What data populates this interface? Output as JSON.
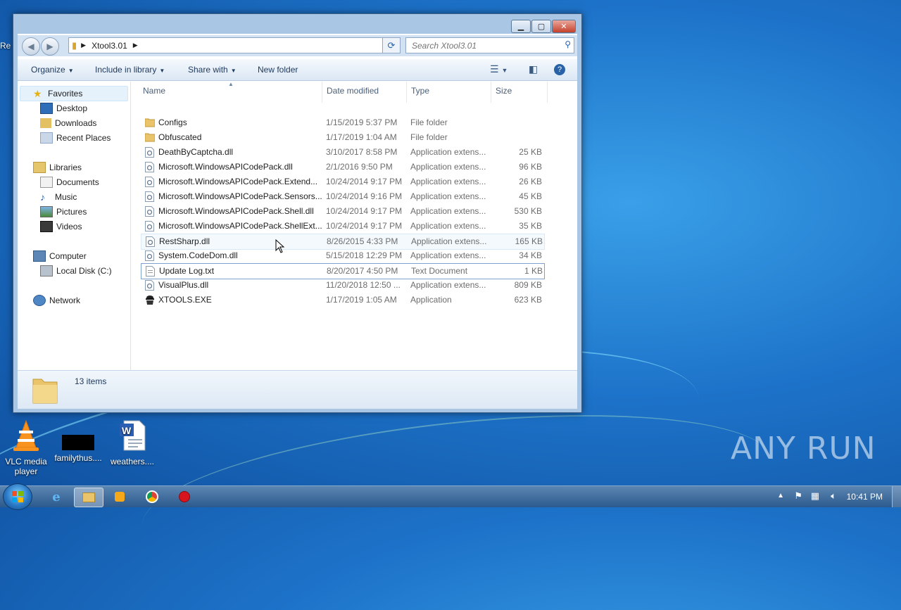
{
  "window": {
    "breadcrumb": [
      "Xtool3.01"
    ],
    "search_placeholder": "Search Xtool3.01",
    "toolbar": {
      "organize": "Organize",
      "include": "Include in library",
      "share": "Share with",
      "new_folder": "New folder"
    },
    "nav": {
      "favorites": "Favorites",
      "desktop": "Desktop",
      "downloads": "Downloads",
      "recent": "Recent Places",
      "libraries": "Libraries",
      "documents": "Documents",
      "music": "Music",
      "pictures": "Pictures",
      "videos": "Videos",
      "computer": "Computer",
      "local_disk": "Local Disk (C:)",
      "network": "Network"
    },
    "columns": {
      "name": "Name",
      "date": "Date modified",
      "type": "Type",
      "size": "Size"
    },
    "files": [
      {
        "icon": "folder",
        "name": "Configs",
        "date": "1/15/2019 5:37 PM",
        "type": "File folder",
        "size": ""
      },
      {
        "icon": "folder",
        "name": "Obfuscated",
        "date": "1/17/2019 1:04 AM",
        "type": "File folder",
        "size": ""
      },
      {
        "icon": "dll",
        "name": "DeathByCaptcha.dll",
        "date": "3/10/2017 8:58 PM",
        "type": "Application extens...",
        "size": "25 KB"
      },
      {
        "icon": "dll",
        "name": "Microsoft.WindowsAPICodePack.dll",
        "date": "2/1/2016 9:50 PM",
        "type": "Application extens...",
        "size": "96 KB"
      },
      {
        "icon": "dll",
        "name": "Microsoft.WindowsAPICodePack.Extend...",
        "date": "10/24/2014 9:17 PM",
        "type": "Application extens...",
        "size": "26 KB"
      },
      {
        "icon": "dll",
        "name": "Microsoft.WindowsAPICodePack.Sensors...",
        "date": "10/24/2014 9:16 PM",
        "type": "Application extens...",
        "size": "45 KB"
      },
      {
        "icon": "dll",
        "name": "Microsoft.WindowsAPICodePack.Shell.dll",
        "date": "10/24/2014 9:17 PM",
        "type": "Application extens...",
        "size": "530 KB"
      },
      {
        "icon": "dll",
        "name": "Microsoft.WindowsAPICodePack.ShellExt...",
        "date": "10/24/2014 9:17 PM",
        "type": "Application extens...",
        "size": "35 KB"
      },
      {
        "icon": "dll",
        "name": "RestSharp.dll",
        "date": "8/26/2015 4:33 PM",
        "type": "Application extens...",
        "size": "165 KB"
      },
      {
        "icon": "dll",
        "name": "System.CodeDom.dll",
        "date": "5/15/2018 12:29 PM",
        "type": "Application extens...",
        "size": "34 KB"
      },
      {
        "icon": "txt",
        "name": "Update Log.txt",
        "date": "8/20/2017 4:50 PM",
        "type": "Text Document",
        "size": "1 KB"
      },
      {
        "icon": "dll",
        "name": "VisualPlus.dll",
        "date": "11/20/2018 12:50 ...",
        "type": "Application extens...",
        "size": "809 KB"
      },
      {
        "icon": "exe",
        "name": "XTOOLS.EXE",
        "date": "1/17/2019 1:05 AM",
        "type": "Application",
        "size": "623 KB"
      }
    ],
    "status_count": "13 items"
  },
  "desktop": {
    "icons": [
      {
        "label": "VLC media player"
      },
      {
        "label": "familythus...."
      },
      {
        "label": "weathers...."
      }
    ],
    "partial_label": "Re"
  },
  "taskbar": {
    "clock": "10:41 PM"
  },
  "watermark": "ANY RUN"
}
